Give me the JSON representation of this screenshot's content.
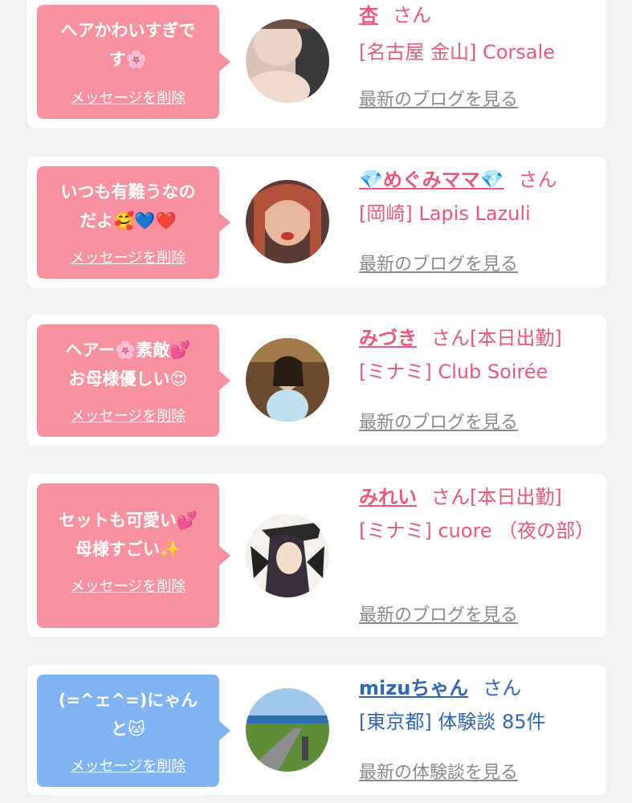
{
  "delete_label": "メッセージを削除",
  "san": "さん",
  "cards": [
    {
      "msg1": "ヘアかわいすぎで",
      "msg2": "す🌸",
      "name": "杏",
      "suffix": "",
      "shop": "[名古屋 金山] Corsale",
      "link": "最新のブログを見る",
      "theme": "pink"
    },
    {
      "msg1": "いつも有難うなの",
      "msg2": "だよ🥰💙❤️",
      "name": "💎めぐみママ💎",
      "suffix": "",
      "shop": "[岡崎] Lapis Lazuli",
      "link": "最新のブログを見る",
      "theme": "pink"
    },
    {
      "msg1": "ヘアー🌸素敵💕",
      "msg2": "お母様優しい😍",
      "name": "みづき",
      "suffix": "[本日出勤]",
      "shop": "[ミナミ] Club Soirée",
      "link": "最新のブログを見る",
      "theme": "pink"
    },
    {
      "msg1": "セットも可愛い💕",
      "msg2": "母様すごい✨",
      "name": "みれい",
      "suffix": "[本日出勤]",
      "shop": "[ミナミ] cuore （夜の部）",
      "link": "最新のブログを見る",
      "theme": "pink"
    },
    {
      "msg1": "(=^ェ^=)にゃん",
      "msg2": "と🐱",
      "name": "mizuちゃん",
      "suffix": "",
      "shop": "[東京都] 体験談 85件",
      "link": "最新の体験談を見る",
      "theme": "blue"
    }
  ]
}
